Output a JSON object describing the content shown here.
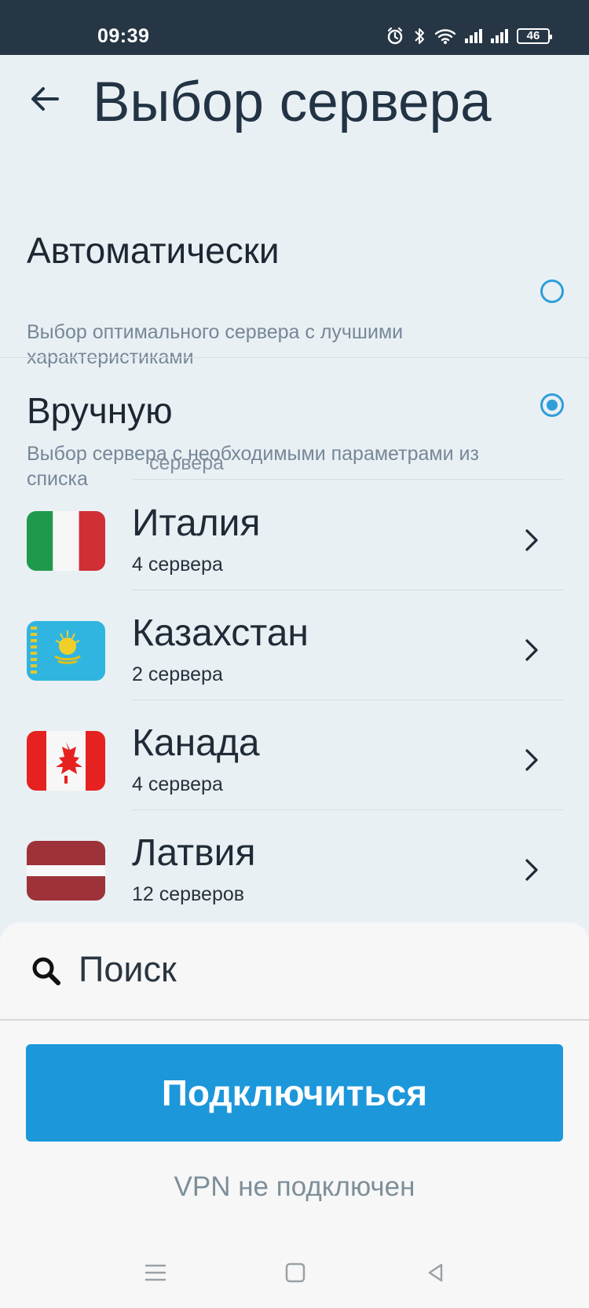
{
  "status_bar": {
    "time": "09:39",
    "battery": "46",
    "icons": [
      "alarm-icon",
      "bluetooth-icon",
      "wifi-icon",
      "signal-icon",
      "signal-icon",
      "battery-icon"
    ]
  },
  "header": {
    "title": "Выбор сервера",
    "back_icon": "arrow-left-icon"
  },
  "options": {
    "auto": {
      "title": "Автоматически",
      "description": "Выбор оптимального сервера с лучшими характеристиками",
      "selected": false
    },
    "manual": {
      "title": "Вручную",
      "description": "Выбор сервера с необходимыми параметрами из списка",
      "selected": true
    }
  },
  "country_list": {
    "partial_text": "сервера",
    "items": [
      {
        "name": "Италия",
        "count": "4 сервера",
        "flag": "italy-flag-icon"
      },
      {
        "name": "Казахстан",
        "count": "2 сервера",
        "flag": "kazakhstan-flag-icon"
      },
      {
        "name": "Канада",
        "count": "4 сервера",
        "flag": "canada-flag-icon"
      },
      {
        "name": "Латвия",
        "count": "12 серверов",
        "flag": "latvia-flag-icon"
      }
    ]
  },
  "search": {
    "placeholder": "Поиск"
  },
  "connect": {
    "label": "Подключиться",
    "status": "VPN не подключен"
  },
  "navigation": {
    "items": [
      "menu-icon",
      "home-square-icon",
      "back-triangle-icon"
    ]
  },
  "colors": {
    "status_bar": "#263645",
    "background": "#e9f0f4",
    "accent": "#1c97da",
    "radio": "#2f9ed9"
  }
}
